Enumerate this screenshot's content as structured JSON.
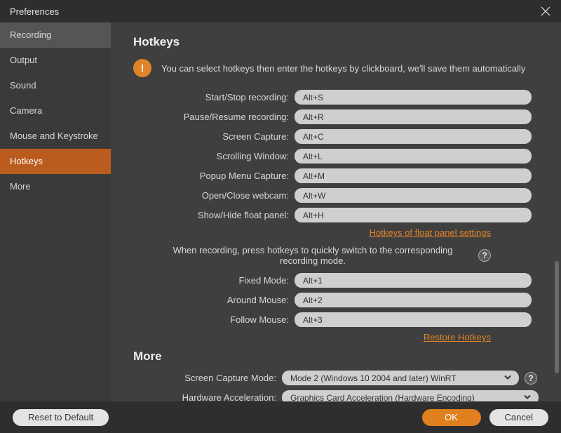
{
  "window": {
    "title": "Preferences"
  },
  "sidebar": {
    "items": [
      {
        "label": "Recording"
      },
      {
        "label": "Output"
      },
      {
        "label": "Sound"
      },
      {
        "label": "Camera"
      },
      {
        "label": "Mouse and Keystroke"
      },
      {
        "label": "Hotkeys"
      },
      {
        "label": "More"
      }
    ]
  },
  "hotkeys": {
    "heading": "Hotkeys",
    "hint_icon": "!",
    "hint": "You can select hotkeys then enter the hotkeys by clickboard, we'll save them automatically",
    "rows": [
      {
        "label": "Start/Stop recording:",
        "value": "Alt+S"
      },
      {
        "label": "Pause/Resume recording:",
        "value": "Alt+R"
      },
      {
        "label": "Screen Capture:",
        "value": "Alt+C"
      },
      {
        "label": "Scrolling Window:",
        "value": "Alt+L"
      },
      {
        "label": "Popup Menu Capture:",
        "value": "Alt+M"
      },
      {
        "label": "Open/Close webcam:",
        "value": "Alt+W"
      },
      {
        "label": "Show/Hide float panel:",
        "value": "Alt+H"
      }
    ],
    "link_float": "Hotkeys of float panel settings",
    "mode_hint": "When recording, press hotkeys to quickly switch to the corresponding recording mode.",
    "mode_rows": [
      {
        "label": "Fixed Mode:",
        "value": "Alt+1"
      },
      {
        "label": "Around Mouse:",
        "value": "Alt+2"
      },
      {
        "label": "Follow Mouse:",
        "value": "Alt+3"
      }
    ],
    "link_restore": "Restore Hotkeys"
  },
  "more": {
    "heading": "More",
    "rows": [
      {
        "label": "Screen Capture Mode:",
        "value": "Mode 2 (Windows 10 2004 and later) WinRT",
        "help": true
      },
      {
        "label": "Hardware Acceleration:",
        "value": "Graphics Card Acceleration (Hardware Encoding)",
        "help": false
      }
    ]
  },
  "footer": {
    "reset": "Reset to Default",
    "ok": "OK",
    "cancel": "Cancel"
  },
  "help_glyph": "?"
}
